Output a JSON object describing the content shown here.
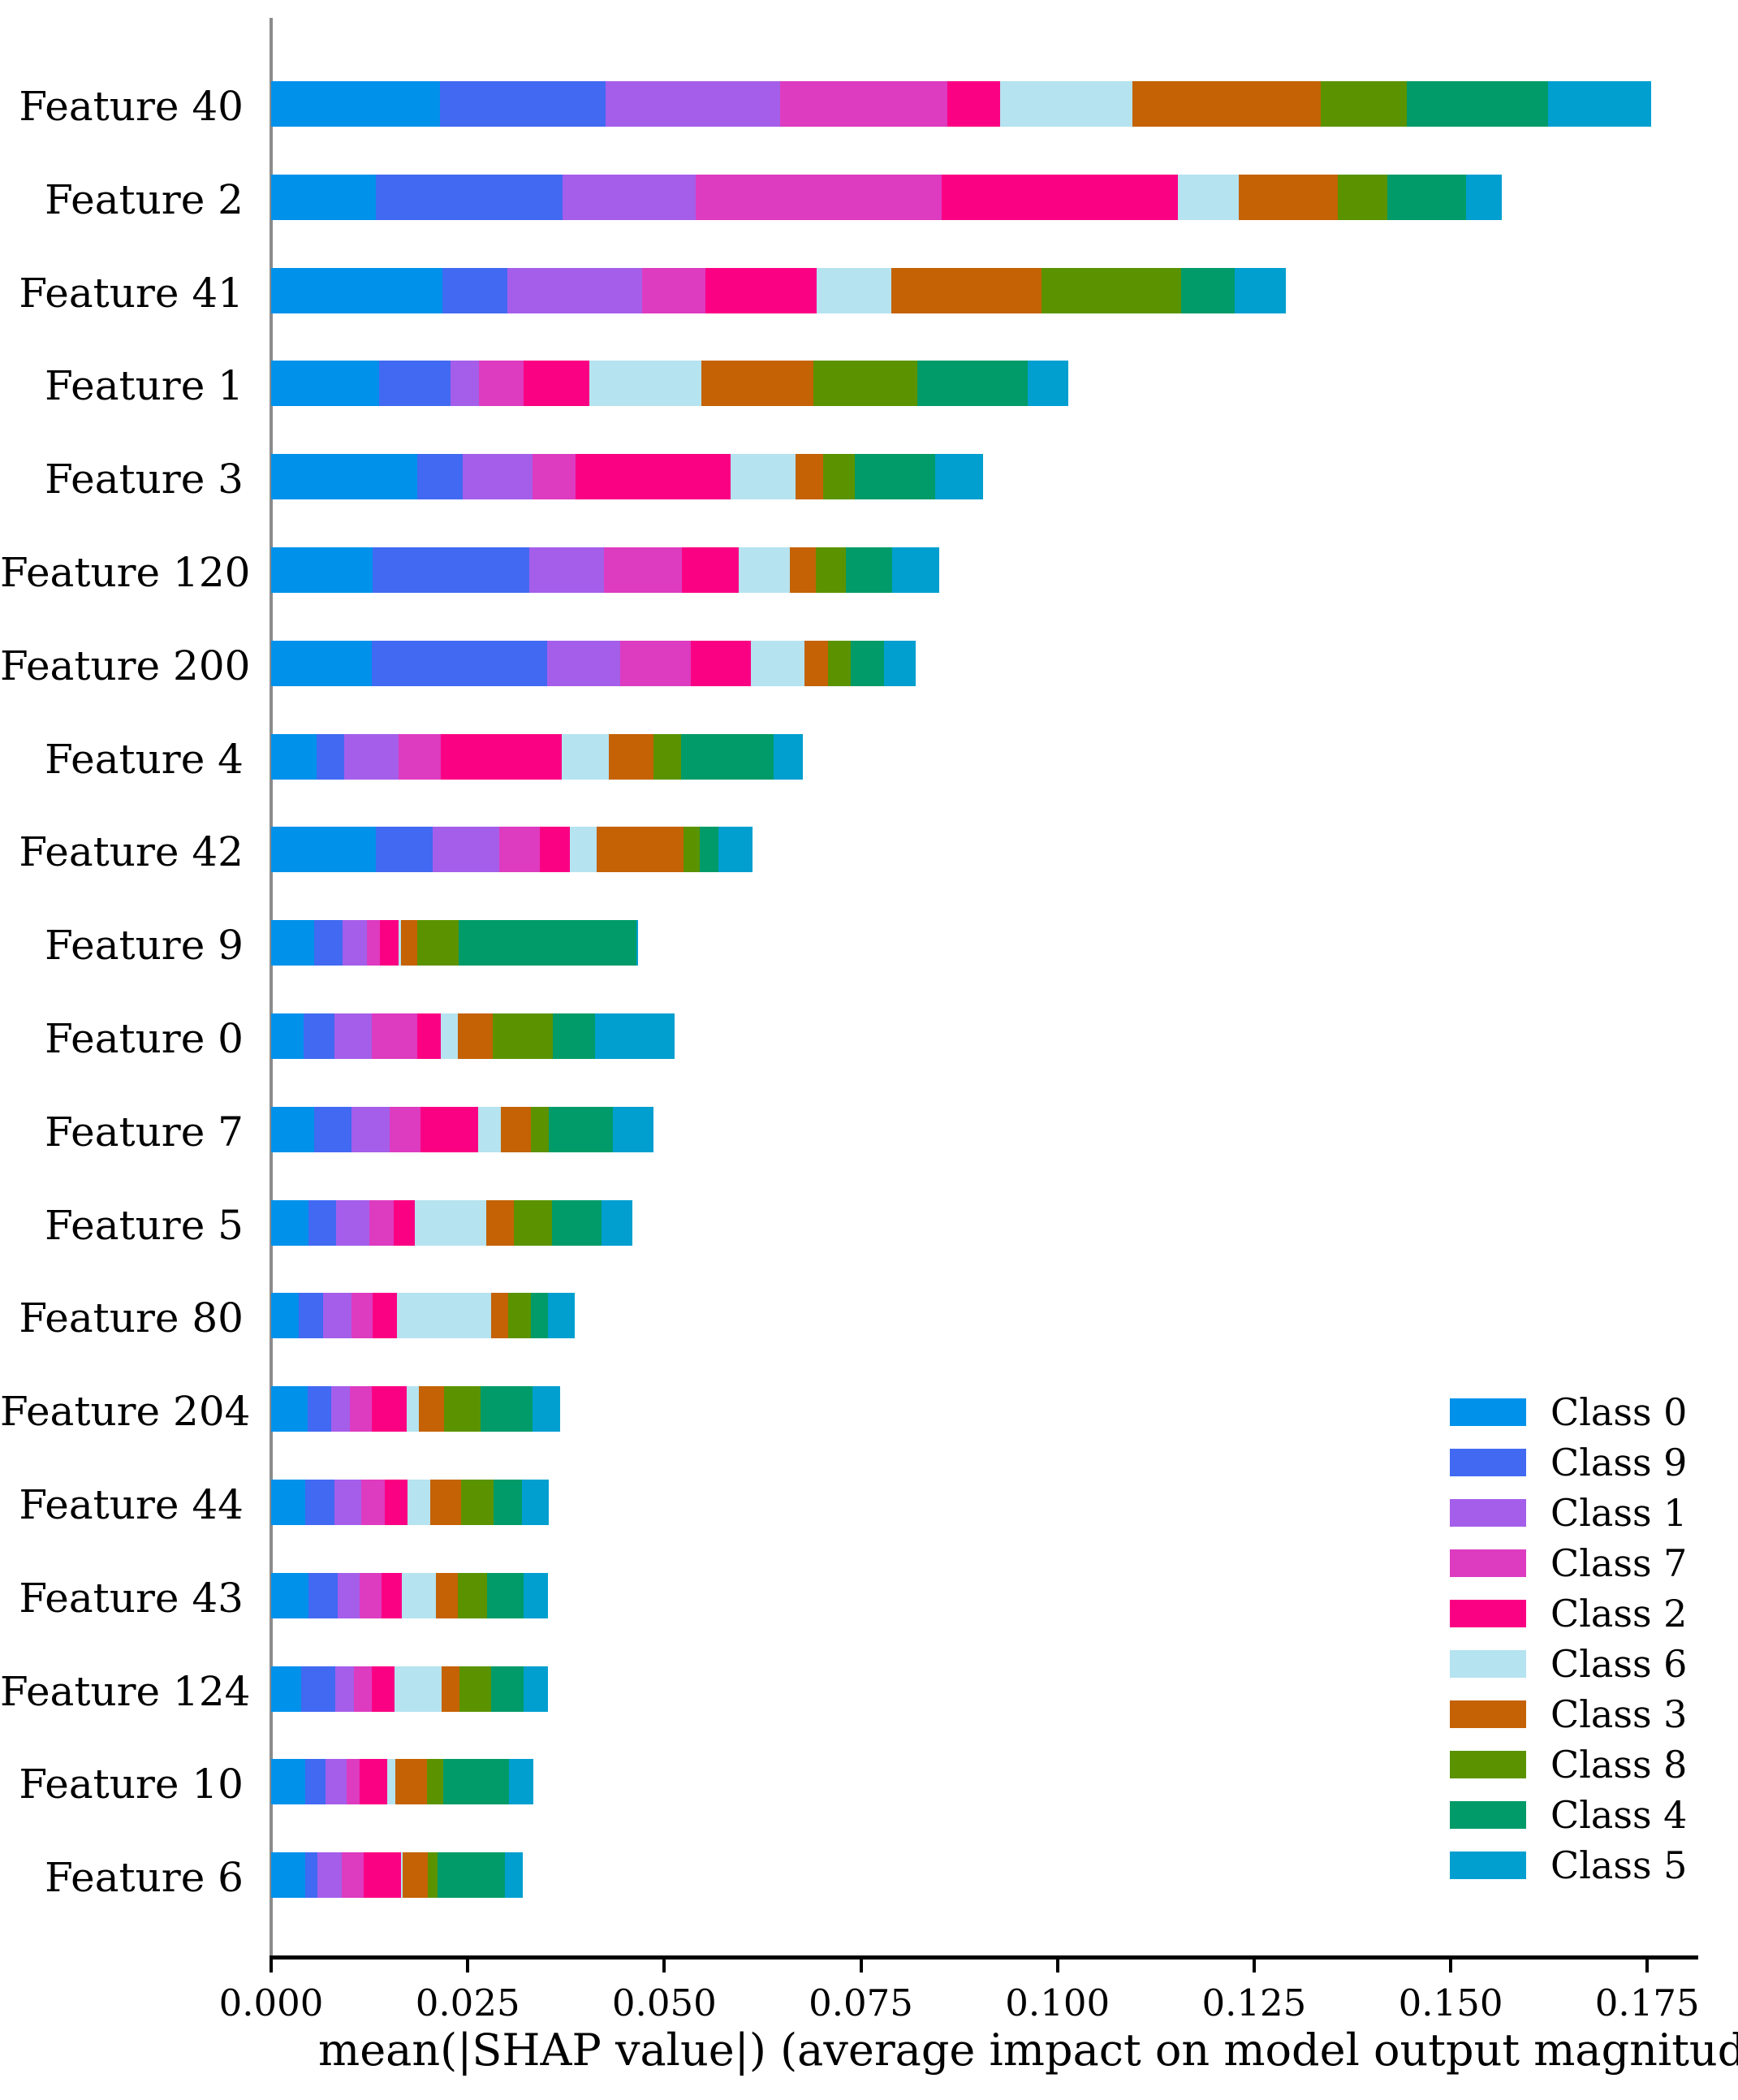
{
  "chart_data": {
    "type": "bar",
    "subtype": "stacked-horizontal",
    "title": "",
    "xlabel": "mean(|SHAP value|) (average impact on model output magnitude)",
    "ylabel": "",
    "xlim": [
      0.0,
      0.1822
    ],
    "xticks": [
      0.0,
      0.025,
      0.05,
      0.075,
      0.1,
      0.125,
      0.15,
      0.175
    ],
    "xtick_labels": [
      "0.000",
      "0.025",
      "0.050",
      "0.075",
      "0.100",
      "0.125",
      "0.150",
      "0.175"
    ],
    "grid": false,
    "legend_position": "center right",
    "categories": [
      "Feature 40",
      "Feature 2",
      "Feature 41",
      "Feature 1",
      "Feature 3",
      "Feature 120",
      "Feature 200",
      "Feature 4",
      "Feature 42",
      "Feature 9",
      "Feature 0",
      "Feature 7",
      "Feature 5",
      "Feature 80",
      "Feature 204",
      "Feature 44",
      "Feature 43",
      "Feature 124",
      "Feature 10",
      "Feature 6"
    ],
    "series": [
      {
        "name": "Class 0",
        "color": "#0091eb",
        "values": [
          0.0215,
          0.0133,
          0.0218,
          0.0137,
          0.0186,
          0.0129,
          0.0128,
          0.0058,
          0.0133,
          0.0055,
          0.0041,
          0.0055,
          0.0047,
          0.0035,
          0.0046,
          0.0043,
          0.0048,
          0.0038,
          0.0043,
          0.0043
        ]
      },
      {
        "name": "Class 9",
        "color": "#4169f2",
        "values": [
          0.021,
          0.0238,
          0.0082,
          0.0091,
          0.0058,
          0.0199,
          0.0223,
          0.0035,
          0.0072,
          0.0036,
          0.004,
          0.0047,
          0.0036,
          0.0031,
          0.003,
          0.0038,
          0.0037,
          0.0044,
          0.0026,
          0.0016
        ]
      },
      {
        "name": "Class 1",
        "color": "#a55eea",
        "values": [
          0.0222,
          0.0169,
          0.0172,
          0.0036,
          0.0088,
          0.0095,
          0.0093,
          0.0069,
          0.0085,
          0.0031,
          0.0047,
          0.0049,
          0.0042,
          0.0036,
          0.0024,
          0.0034,
          0.0028,
          0.0023,
          0.0027,
          0.0031
        ]
      },
      {
        "name": "Class 7",
        "color": "#dd3bc0",
        "values": [
          0.0213,
          0.0313,
          0.008,
          0.0057,
          0.0055,
          0.0099,
          0.009,
          0.0054,
          0.0052,
          0.0016,
          0.0058,
          0.0039,
          0.0031,
          0.0027,
          0.0028,
          0.003,
          0.0027,
          0.0023,
          0.0017,
          0.0028
        ]
      },
      {
        "name": "Class 2",
        "color": "#fa0184",
        "values": [
          0.0067,
          0.03,
          0.0142,
          0.0084,
          0.0197,
          0.0073,
          0.0076,
          0.0154,
          0.0038,
          0.0024,
          0.003,
          0.0073,
          0.0027,
          0.0031,
          0.0044,
          0.0028,
          0.0026,
          0.0029,
          0.0035,
          0.0047
        ]
      },
      {
        "name": "Class 6",
        "color": "#b5e3f0",
        "values": [
          0.0168,
          0.0078,
          0.0095,
          0.0142,
          0.0083,
          0.0065,
          0.0068,
          0.0059,
          0.0034,
          0.0003,
          0.0022,
          0.0029,
          0.0091,
          0.012,
          0.0016,
          0.0029,
          0.0044,
          0.006,
          0.001,
          0.0002
        ]
      },
      {
        "name": "Class 3",
        "color": "#c46205",
        "values": [
          0.024,
          0.0126,
          0.0191,
          0.0143,
          0.0035,
          0.0033,
          0.003,
          0.0057,
          0.0111,
          0.0021,
          0.0044,
          0.0038,
          0.0035,
          0.0022,
          0.0032,
          0.004,
          0.0028,
          0.0023,
          0.004,
          0.0032
        ]
      },
      {
        "name": "Class 8",
        "color": "#5b9300",
        "values": [
          0.0109,
          0.0062,
          0.0177,
          0.0132,
          0.004,
          0.0038,
          0.0029,
          0.0035,
          0.002,
          0.0053,
          0.0076,
          0.0023,
          0.0048,
          0.0028,
          0.0046,
          0.0041,
          0.0037,
          0.004,
          0.0021,
          0.0013
        ]
      },
      {
        "name": "Class 4",
        "color": "#009b68",
        "values": [
          0.018,
          0.0101,
          0.0068,
          0.014,
          0.0103,
          0.0059,
          0.0043,
          0.0118,
          0.0024,
          0.0226,
          0.0054,
          0.0082,
          0.0063,
          0.0022,
          0.0067,
          0.0036,
          0.0046,
          0.0041,
          0.0084,
          0.0085
        ]
      },
      {
        "name": "Class 5",
        "color": "#009fd0",
        "values": [
          0.0131,
          0.0045,
          0.0065,
          0.0052,
          0.006,
          0.006,
          0.004,
          0.0037,
          0.0043,
          0.0002,
          0.0101,
          0.0051,
          0.0039,
          0.0034,
          0.0035,
          0.0034,
          0.0031,
          0.0031,
          0.0031,
          0.0023
        ]
      }
    ],
    "totals": [
      0.1755,
      0.1565,
      0.129,
      0.1164,
      0.0905,
      0.085,
      0.082,
      0.0676,
      0.0612,
      0.0467,
      0.0513,
      0.0486,
      0.0459,
      0.0386,
      0.0368,
      0.0353,
      0.0352,
      0.0352,
      0.0334,
      0.032
    ]
  },
  "axis": {
    "x_title": "mean(|SHAP value|) (average impact on model output magnitude)"
  },
  "legend": {
    "entries": [
      {
        "label": "Class 0",
        "color": "#0091eb"
      },
      {
        "label": "Class 9",
        "color": "#4169f2"
      },
      {
        "label": "Class 1",
        "color": "#a55eea"
      },
      {
        "label": "Class 7",
        "color": "#dd3bc0"
      },
      {
        "label": "Class 2",
        "color": "#fa0184"
      },
      {
        "label": "Class 6",
        "color": "#b5e3f0"
      },
      {
        "label": "Class 3",
        "color": "#c46205"
      },
      {
        "label": "Class 8",
        "color": "#5b9300"
      },
      {
        "label": "Class 4",
        "color": "#009b68"
      },
      {
        "label": "Class 5",
        "color": "#009fd0"
      }
    ]
  }
}
